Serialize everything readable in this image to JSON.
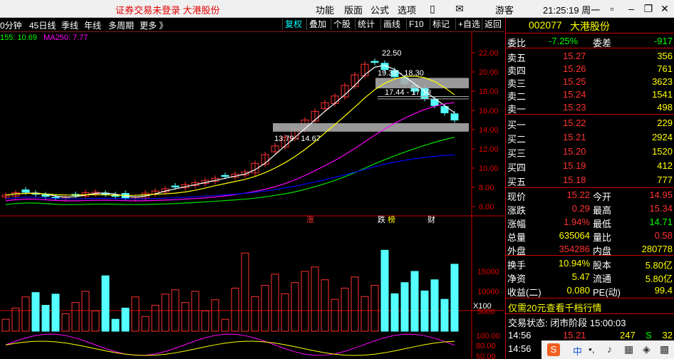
{
  "titlebar": {
    "notice": "证券交易未登录 大港股份",
    "menu": [
      "功能",
      "版面",
      "公式",
      "选项"
    ],
    "user": "游客",
    "time": "21:25:19 周一"
  },
  "toolbar": {
    "periods": [
      "0分钟",
      "45日线",
      "季线",
      "年线",
      "多周期",
      "更多 》"
    ],
    "buttons": [
      "复权",
      "叠加",
      "个股",
      "统计",
      "画线",
      "F10",
      "标记",
      "+自选",
      "返回"
    ]
  },
  "ma_legend": {
    "a": "155: 10.69",
    "b": "MA250: 7.77"
  },
  "price_axis": [
    "22.00",
    "20.00",
    "18.00",
    "16.00",
    "14.00",
    "12.00",
    "10.00",
    "8.00",
    "6.00"
  ],
  "volume_axis": [
    "15000",
    "10000",
    "5000",
    "X100"
  ],
  "indicator_axis": [
    "100.00",
    "80.00",
    "50.00"
  ],
  "annotations": {
    "high": "22.50",
    "zone1": "19.38 - 18.30",
    "zone2": "17.44 - 17.19",
    "zone3": "13.79 - 14.67"
  },
  "event_markers": [
    "涨",
    "跌",
    "榜",
    "财"
  ],
  "colors": {
    "up": "#ff3232",
    "down": "#54ffff",
    "ma_white": "#ffffff",
    "ma_yellow": "#ffff00",
    "ma_magenta": "#ff00ff",
    "ma_green": "#00e000",
    "ma_blue": "#0000ff"
  },
  "stock": {
    "code": "002077",
    "name": "大港股份"
  },
  "orderbook": {
    "commission_ratio_label": "委比",
    "commission_ratio": "-7.25%",
    "commission_diff_label": "委差",
    "commission_diff": "-917",
    "asks": [
      {
        "label": "卖五",
        "price": "15.27",
        "vol": "356"
      },
      {
        "label": "卖四",
        "price": "15.26",
        "vol": "761"
      },
      {
        "label": "卖三",
        "price": "15.25",
        "vol": "3623"
      },
      {
        "label": "卖二",
        "price": "15.24",
        "vol": "1541"
      },
      {
        "label": "卖一",
        "price": "15.23",
        "vol": "498"
      }
    ],
    "bids": [
      {
        "label": "买一",
        "price": "15.22",
        "vol": "229"
      },
      {
        "label": "买二",
        "price": "15.21",
        "vol": "2924"
      },
      {
        "label": "买三",
        "price": "15.20",
        "vol": "1520"
      },
      {
        "label": "买四",
        "price": "15.19",
        "vol": "412"
      },
      {
        "label": "买五",
        "price": "15.18",
        "vol": "777"
      }
    ]
  },
  "quote": {
    "rows": [
      {
        "l1": "现价",
        "v1": "15.22",
        "l2": "今开",
        "v2": "14.95"
      },
      {
        "l1": "涨跌",
        "v1": "0.29",
        "l2": "最高",
        "v2": "15.34"
      },
      {
        "l1": "涨幅",
        "v1": "1.94%",
        "l2": "最低",
        "v2": "14.71"
      },
      {
        "l1": "总量",
        "v1": "635064",
        "l2": "量比",
        "v2": "0.58"
      },
      {
        "l1": "外盘",
        "v1": "354286",
        "l2": "内盘",
        "v2": "280778"
      }
    ],
    "rows2": [
      {
        "l1": "换手",
        "v1": "10.94%",
        "l2": "股本",
        "v2": "5.80亿"
      },
      {
        "l1": "净资",
        "v1": "5.47",
        "l2": "流通",
        "v2": "5.80亿"
      },
      {
        "l1": "收益(二)",
        "v1": "0.080",
        "l2": "PE(动)",
        "v2": "99.4"
      }
    ]
  },
  "promo": "仅需20元查看千档行情",
  "trade_status": "交易状态: 闭市阶段 15:00:03",
  "ticks": [
    {
      "time": "14:56",
      "price": "15.21",
      "vol": "247",
      "side": "S",
      "num": "32"
    },
    {
      "time": "14:56",
      "price": "",
      "vol": "",
      "side": "",
      "num": ""
    }
  ],
  "tray": {
    "ime": "中"
  }
}
